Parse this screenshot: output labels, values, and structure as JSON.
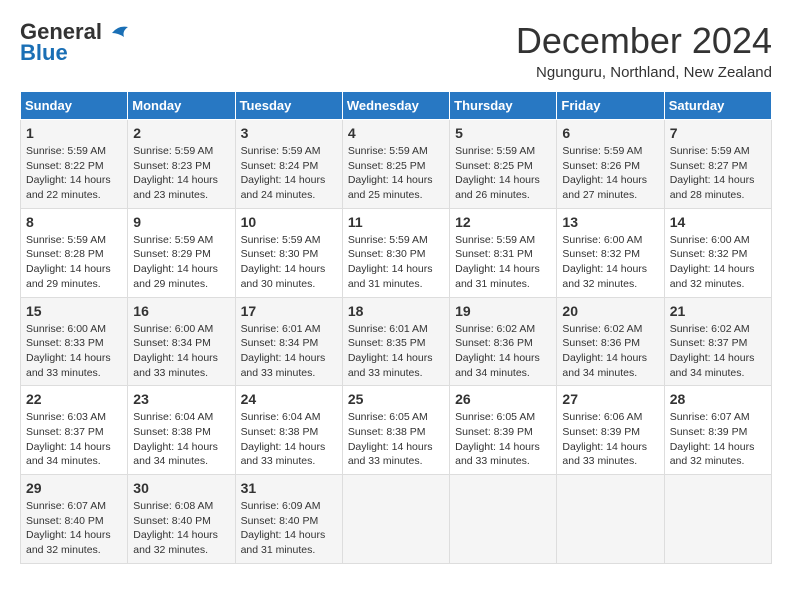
{
  "header": {
    "logo_line1": "General",
    "logo_line2": "Blue",
    "month_title": "December 2024",
    "location": "Ngunguru, Northland, New Zealand"
  },
  "days_of_week": [
    "Sunday",
    "Monday",
    "Tuesday",
    "Wednesday",
    "Thursday",
    "Friday",
    "Saturday"
  ],
  "weeks": [
    [
      {
        "day": "1",
        "sunrise": "5:59 AM",
        "sunset": "8:22 PM",
        "daylight": "14 hours and 22 minutes."
      },
      {
        "day": "2",
        "sunrise": "5:59 AM",
        "sunset": "8:23 PM",
        "daylight": "14 hours and 23 minutes."
      },
      {
        "day": "3",
        "sunrise": "5:59 AM",
        "sunset": "8:24 PM",
        "daylight": "14 hours and 24 minutes."
      },
      {
        "day": "4",
        "sunrise": "5:59 AM",
        "sunset": "8:25 PM",
        "daylight": "14 hours and 25 minutes."
      },
      {
        "day": "5",
        "sunrise": "5:59 AM",
        "sunset": "8:25 PM",
        "daylight": "14 hours and 26 minutes."
      },
      {
        "day": "6",
        "sunrise": "5:59 AM",
        "sunset": "8:26 PM",
        "daylight": "14 hours and 27 minutes."
      },
      {
        "day": "7",
        "sunrise": "5:59 AM",
        "sunset": "8:27 PM",
        "daylight": "14 hours and 28 minutes."
      }
    ],
    [
      {
        "day": "8",
        "sunrise": "5:59 AM",
        "sunset": "8:28 PM",
        "daylight": "14 hours and 29 minutes."
      },
      {
        "day": "9",
        "sunrise": "5:59 AM",
        "sunset": "8:29 PM",
        "daylight": "14 hours and 29 minutes."
      },
      {
        "day": "10",
        "sunrise": "5:59 AM",
        "sunset": "8:30 PM",
        "daylight": "14 hours and 30 minutes."
      },
      {
        "day": "11",
        "sunrise": "5:59 AM",
        "sunset": "8:30 PM",
        "daylight": "14 hours and 31 minutes."
      },
      {
        "day": "12",
        "sunrise": "5:59 AM",
        "sunset": "8:31 PM",
        "daylight": "14 hours and 31 minutes."
      },
      {
        "day": "13",
        "sunrise": "6:00 AM",
        "sunset": "8:32 PM",
        "daylight": "14 hours and 32 minutes."
      },
      {
        "day": "14",
        "sunrise": "6:00 AM",
        "sunset": "8:32 PM",
        "daylight": "14 hours and 32 minutes."
      }
    ],
    [
      {
        "day": "15",
        "sunrise": "6:00 AM",
        "sunset": "8:33 PM",
        "daylight": "14 hours and 33 minutes."
      },
      {
        "day": "16",
        "sunrise": "6:00 AM",
        "sunset": "8:34 PM",
        "daylight": "14 hours and 33 minutes."
      },
      {
        "day": "17",
        "sunrise": "6:01 AM",
        "sunset": "8:34 PM",
        "daylight": "14 hours and 33 minutes."
      },
      {
        "day": "18",
        "sunrise": "6:01 AM",
        "sunset": "8:35 PM",
        "daylight": "14 hours and 33 minutes."
      },
      {
        "day": "19",
        "sunrise": "6:02 AM",
        "sunset": "8:36 PM",
        "daylight": "14 hours and 34 minutes."
      },
      {
        "day": "20",
        "sunrise": "6:02 AM",
        "sunset": "8:36 PM",
        "daylight": "14 hours and 34 minutes."
      },
      {
        "day": "21",
        "sunrise": "6:02 AM",
        "sunset": "8:37 PM",
        "daylight": "14 hours and 34 minutes."
      }
    ],
    [
      {
        "day": "22",
        "sunrise": "6:03 AM",
        "sunset": "8:37 PM",
        "daylight": "14 hours and 34 minutes."
      },
      {
        "day": "23",
        "sunrise": "6:04 AM",
        "sunset": "8:38 PM",
        "daylight": "14 hours and 34 minutes."
      },
      {
        "day": "24",
        "sunrise": "6:04 AM",
        "sunset": "8:38 PM",
        "daylight": "14 hours and 33 minutes."
      },
      {
        "day": "25",
        "sunrise": "6:05 AM",
        "sunset": "8:38 PM",
        "daylight": "14 hours and 33 minutes."
      },
      {
        "day": "26",
        "sunrise": "6:05 AM",
        "sunset": "8:39 PM",
        "daylight": "14 hours and 33 minutes."
      },
      {
        "day": "27",
        "sunrise": "6:06 AM",
        "sunset": "8:39 PM",
        "daylight": "14 hours and 33 minutes."
      },
      {
        "day": "28",
        "sunrise": "6:07 AM",
        "sunset": "8:39 PM",
        "daylight": "14 hours and 32 minutes."
      }
    ],
    [
      {
        "day": "29",
        "sunrise": "6:07 AM",
        "sunset": "8:40 PM",
        "daylight": "14 hours and 32 minutes."
      },
      {
        "day": "30",
        "sunrise": "6:08 AM",
        "sunset": "8:40 PM",
        "daylight": "14 hours and 32 minutes."
      },
      {
        "day": "31",
        "sunrise": "6:09 AM",
        "sunset": "8:40 PM",
        "daylight": "14 hours and 31 minutes."
      },
      null,
      null,
      null,
      null
    ]
  ]
}
